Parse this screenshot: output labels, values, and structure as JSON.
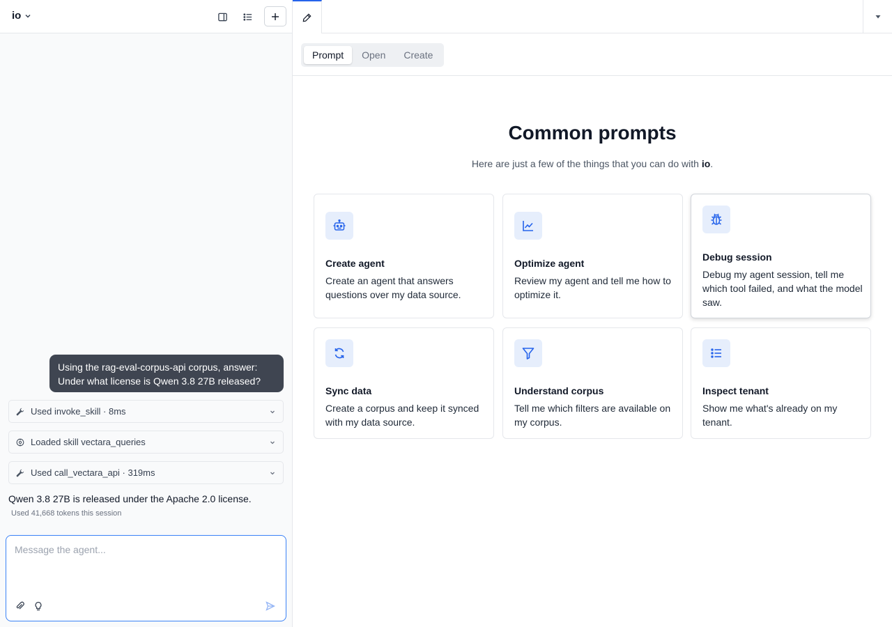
{
  "sidebar": {
    "workspace_name": "io",
    "user_message": "Using the rag-eval-corpus-api corpus, answer: Under what license is Qwen 3.8 27B released?",
    "tool_events": [
      {
        "label": "Used invoke_skill · 8ms",
        "icon": "wrench-icon"
      },
      {
        "label": "Loaded skill vectara_queries",
        "icon": "skill-icon"
      },
      {
        "label": "Used call_vectara_api · 319ms",
        "icon": "wrench-icon"
      }
    ],
    "assistant_answer": "Qwen 3.8 27B is released under the Apache 2.0 license.",
    "token_usage": "Used 41,668 tokens this session",
    "composer_placeholder": "Message the agent..."
  },
  "main": {
    "segments": [
      "Prompt",
      "Open",
      "Create"
    ],
    "active_segment": "Prompt",
    "heading": "Common prompts",
    "subheading_prefix": "Here are just a few of the things that you can do with ",
    "subheading_brand": "io",
    "subheading_suffix": ".",
    "cards": [
      {
        "icon": "robot-icon",
        "title": "Create agent",
        "desc": "Create an agent that answers questions over my data source."
      },
      {
        "icon": "chart-icon",
        "title": "Optimize agent",
        "desc": "Review my agent and tell me how to optimize it."
      },
      {
        "icon": "bug-icon",
        "title": "Debug session",
        "desc": "Debug my agent session, tell me which tool failed, and what the model saw."
      },
      {
        "icon": "sync-icon",
        "title": "Sync data",
        "desc": "Create a corpus and keep it synced with my data source."
      },
      {
        "icon": "filter-icon",
        "title": "Understand corpus",
        "desc": "Tell me which filters are available on my corpus."
      },
      {
        "icon": "list-icon",
        "title": "Inspect tenant",
        "desc": "Show me what's already on my tenant."
      }
    ]
  },
  "colors": {
    "accent": "#2563eb",
    "bubble_bg": "#3f4551",
    "icon_tile_bg": "#e6eefc"
  }
}
